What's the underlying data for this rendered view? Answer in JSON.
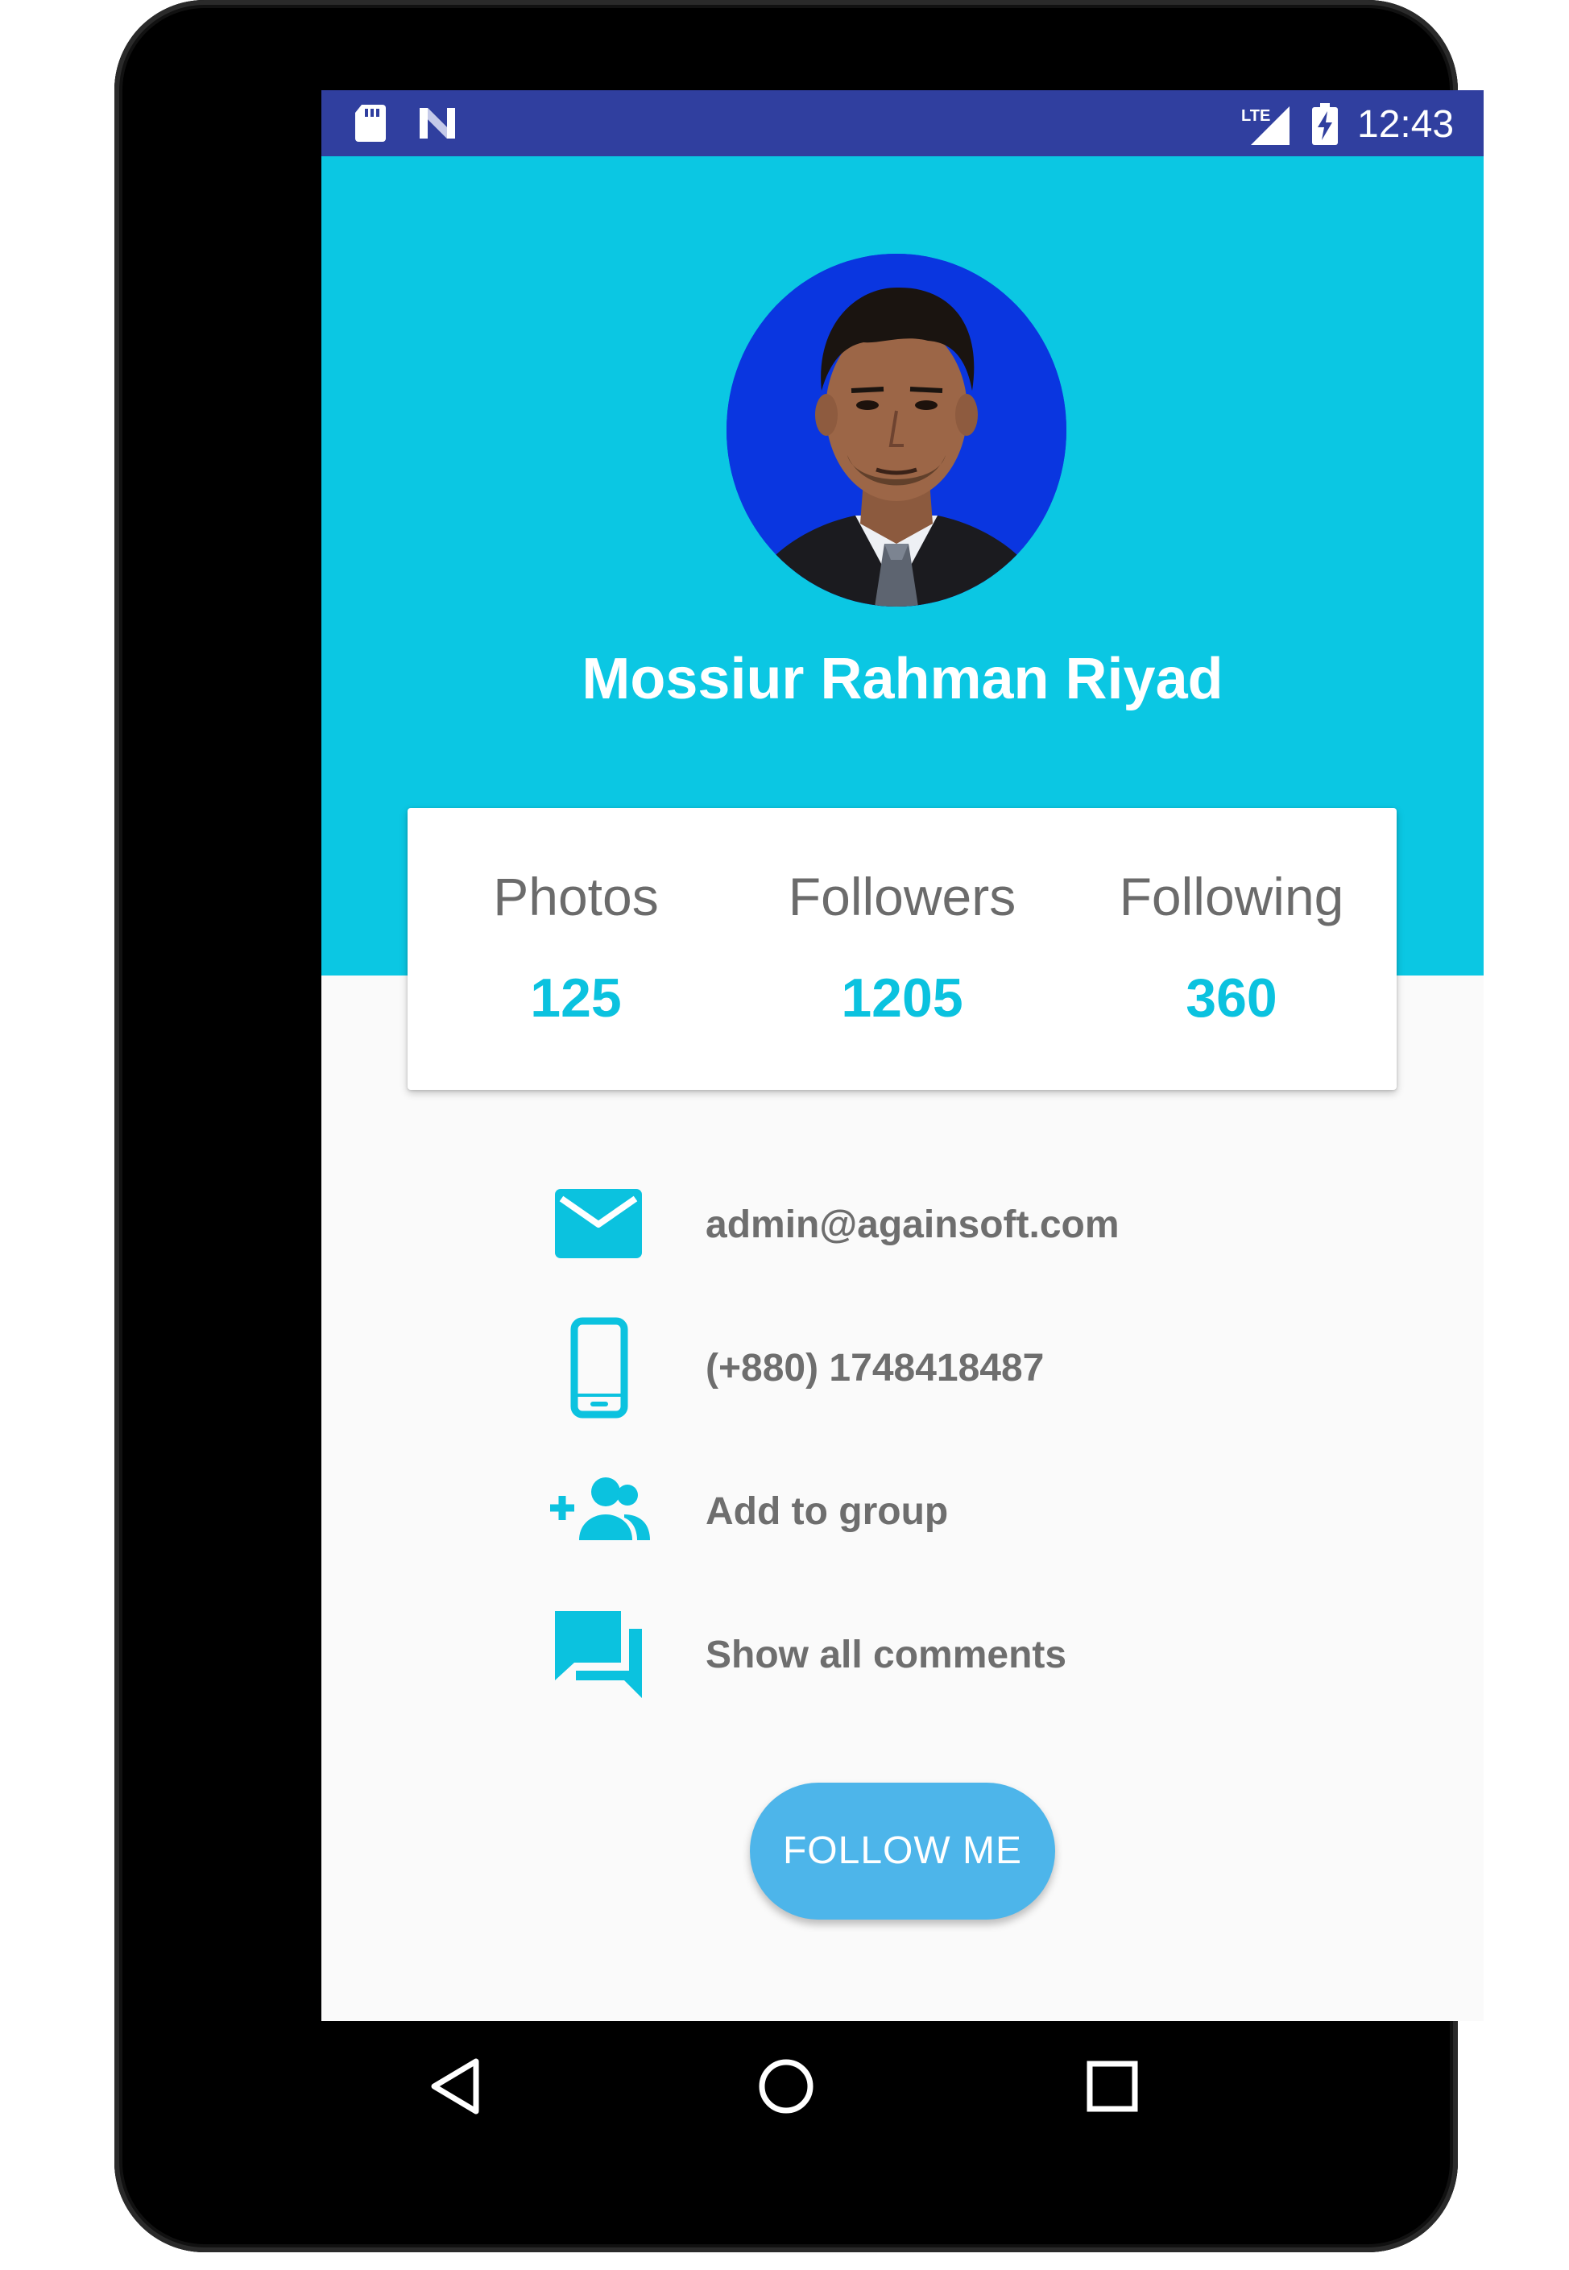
{
  "status_bar": {
    "time": "12:43",
    "network_label": "LTE",
    "left_icons": [
      "sd-card-icon",
      "n-logo-icon"
    ],
    "right_icons": [
      "lte-signal-icon",
      "battery-charging-icon"
    ]
  },
  "profile": {
    "name": "Mossiur Rahman Riyad",
    "avatar_bg_color": "#0a36e0"
  },
  "stats": [
    {
      "label": "Photos",
      "value": "125"
    },
    {
      "label": "Followers",
      "value": "1205"
    },
    {
      "label": "Following",
      "value": "360"
    }
  ],
  "info_items": [
    {
      "icon": "email-icon",
      "text": "admin@againsoft.com"
    },
    {
      "icon": "phone-icon",
      "text": "(+880) 1748418487"
    },
    {
      "icon": "add-group-icon",
      "text": "Add to group"
    },
    {
      "icon": "comments-icon",
      "text": "Show all comments"
    }
  ],
  "follow_button": {
    "label": "FOLLOW ME"
  },
  "nav_bar": {
    "icons": [
      "back-icon",
      "home-icon",
      "recents-icon"
    ]
  },
  "colors": {
    "status_bar": "#303f9f",
    "header": "#0bc7e3",
    "accent": "#0bc2df",
    "button": "#4db5ea",
    "body_bg": "#fafafa"
  }
}
